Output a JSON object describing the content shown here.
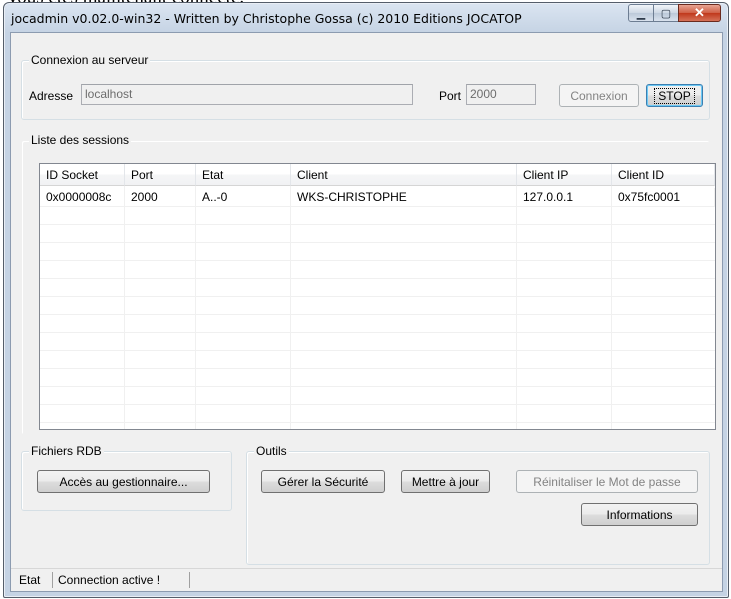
{
  "caption": "Vous êtes maintenant connecté.",
  "window": {
    "title": "jocadmin v0.02.0-win32 - Written by Christophe Gossa (c) 2010 Editions JOCATOP",
    "minimize_glyph": "▁",
    "maximize_glyph": "▢",
    "close_glyph": "✕"
  },
  "server": {
    "legend": "Connexion au serveur",
    "address_label": "Adresse",
    "address_value": "localhost",
    "port_label": "Port",
    "port_value": "2000",
    "connect_button": "Connexion",
    "stop_button": "STOP"
  },
  "sessions": {
    "legend": "Liste des sessions",
    "columns": [
      "ID Socket",
      "Port",
      "Etat",
      "Client",
      "Client IP",
      "Client ID"
    ],
    "rows": [
      [
        "0x0000008c",
        "2000",
        "A..-0",
        "WKS-CHRISTOPHE",
        "127.0.0.1",
        "0x75fc0001"
      ]
    ]
  },
  "rdb": {
    "legend": "Fichiers RDB",
    "manager_button": "Accès au gestionnaire..."
  },
  "tools": {
    "legend": "Outils",
    "security_button": "Gérer la Sécurité",
    "update_button": "Mettre à jour",
    "reset_password_button": "Réinitaliser le Mot de passe",
    "info_button": "Informations"
  },
  "status": {
    "label": "Etat",
    "message": "Connection active !"
  },
  "colors": {
    "window_frame": "#c5d3e4",
    "dialog_bg": "#f0f0f0",
    "close_red": "#c0381c"
  }
}
